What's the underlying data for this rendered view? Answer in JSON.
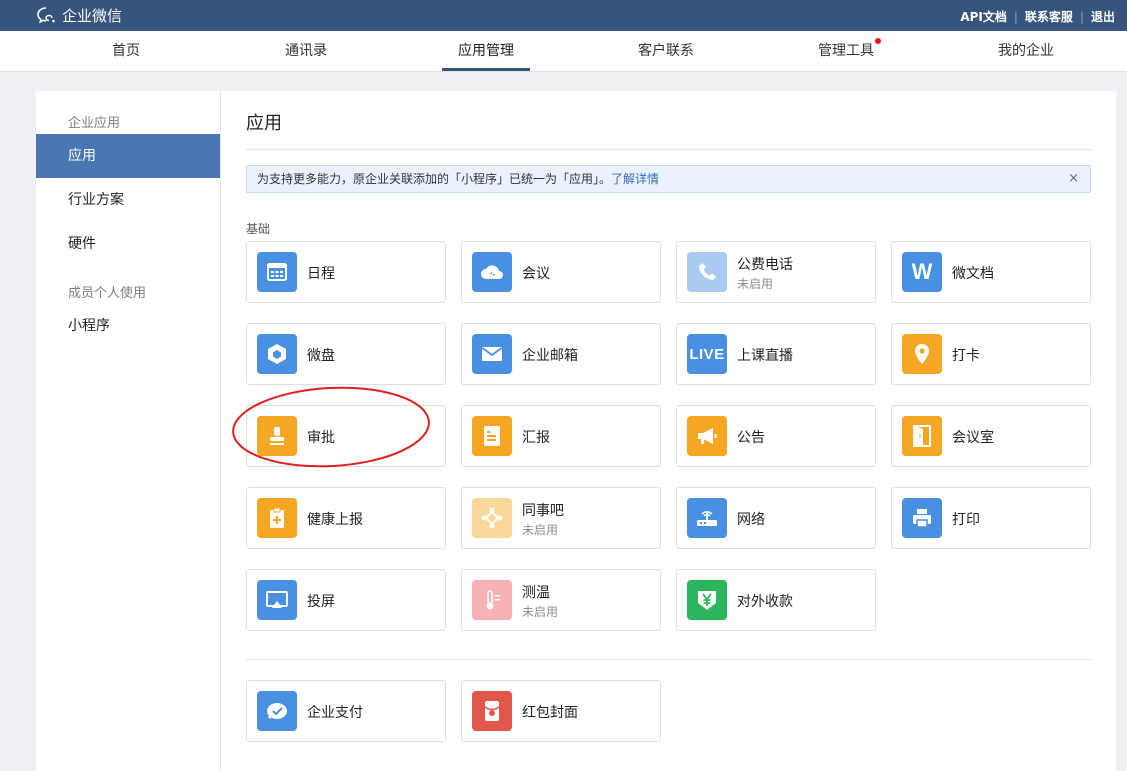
{
  "topbar": {
    "brand": "企业微信",
    "links": [
      "API文档",
      "联系客服",
      "退出"
    ]
  },
  "nav": {
    "items": [
      "首页",
      "通讯录",
      "应用管理",
      "客户联系",
      "管理工具",
      "我的企业"
    ],
    "active": "应用管理"
  },
  "sidebar": {
    "group1": "企业应用",
    "items1": [
      "应用",
      "行业方案",
      "硬件"
    ],
    "group2": "成员个人使用",
    "items2": [
      "小程序"
    ]
  },
  "main": {
    "title": "应用",
    "notice": {
      "text": "为支持更多能力，原企业关联添加的「小程序」已统一为「应用」。",
      "link": "了解详情",
      "close": "×"
    },
    "section_label": "基础",
    "cards": [
      {
        "name": "日程",
        "sub": "",
        "icon": "calendar-icon",
        "color": "#4a90e2"
      },
      {
        "name": "会议",
        "sub": "",
        "icon": "cloud-meeting-icon",
        "color": "#4a90e2"
      },
      {
        "name": "公费电话",
        "sub": "未启用",
        "icon": "phone-icon",
        "color": "#a9cbf2"
      },
      {
        "name": "微文档",
        "sub": "",
        "icon": "w-doc-icon",
        "color": "#4a90e2"
      },
      {
        "name": "微盘",
        "sub": "",
        "icon": "drive-icon",
        "color": "#4a90e2"
      },
      {
        "name": "企业邮箱",
        "sub": "",
        "icon": "mail-icon",
        "color": "#4a90e2"
      },
      {
        "name": "上课直播",
        "sub": "",
        "icon": "live-icon",
        "color": "#4a90e2"
      },
      {
        "name": "打卡",
        "sub": "",
        "icon": "location-pin-icon",
        "color": "#f5a623"
      },
      {
        "name": "审批",
        "sub": "",
        "icon": "stamp-icon",
        "color": "#f5a623"
      },
      {
        "name": "汇报",
        "sub": "",
        "icon": "report-icon",
        "color": "#f5a623"
      },
      {
        "name": "公告",
        "sub": "",
        "icon": "megaphone-icon",
        "color": "#f5a623"
      },
      {
        "name": "会议室",
        "sub": "",
        "icon": "door-icon",
        "color": "#f5a623"
      },
      {
        "name": "健康上报",
        "sub": "",
        "icon": "health-report-icon",
        "color": "#f5a623"
      },
      {
        "name": "同事吧",
        "sub": "未启用",
        "icon": "community-icon",
        "color": "#fad89a"
      },
      {
        "name": "网络",
        "sub": "",
        "icon": "router-icon",
        "color": "#4a90e2"
      },
      {
        "name": "打印",
        "sub": "",
        "icon": "printer-icon",
        "color": "#4a90e2"
      },
      {
        "name": "投屏",
        "sub": "",
        "icon": "screen-cast-icon",
        "color": "#4a90e2"
      },
      {
        "name": "测温",
        "sub": "未启用",
        "icon": "thermometer-icon",
        "color": "#f7b3b3"
      },
      {
        "name": "对外收款",
        "sub": "",
        "icon": "payment-shield-icon",
        "color": "#2bb55c"
      }
    ],
    "bottom_cards": [
      {
        "name": "企业支付",
        "sub": "",
        "icon": "pay-icon",
        "color": "#4a90e2"
      },
      {
        "name": "红包封面",
        "sub": "",
        "icon": "red-packet-icon",
        "color": "#e2574c"
      }
    ],
    "annotation_color": "#e02020"
  }
}
